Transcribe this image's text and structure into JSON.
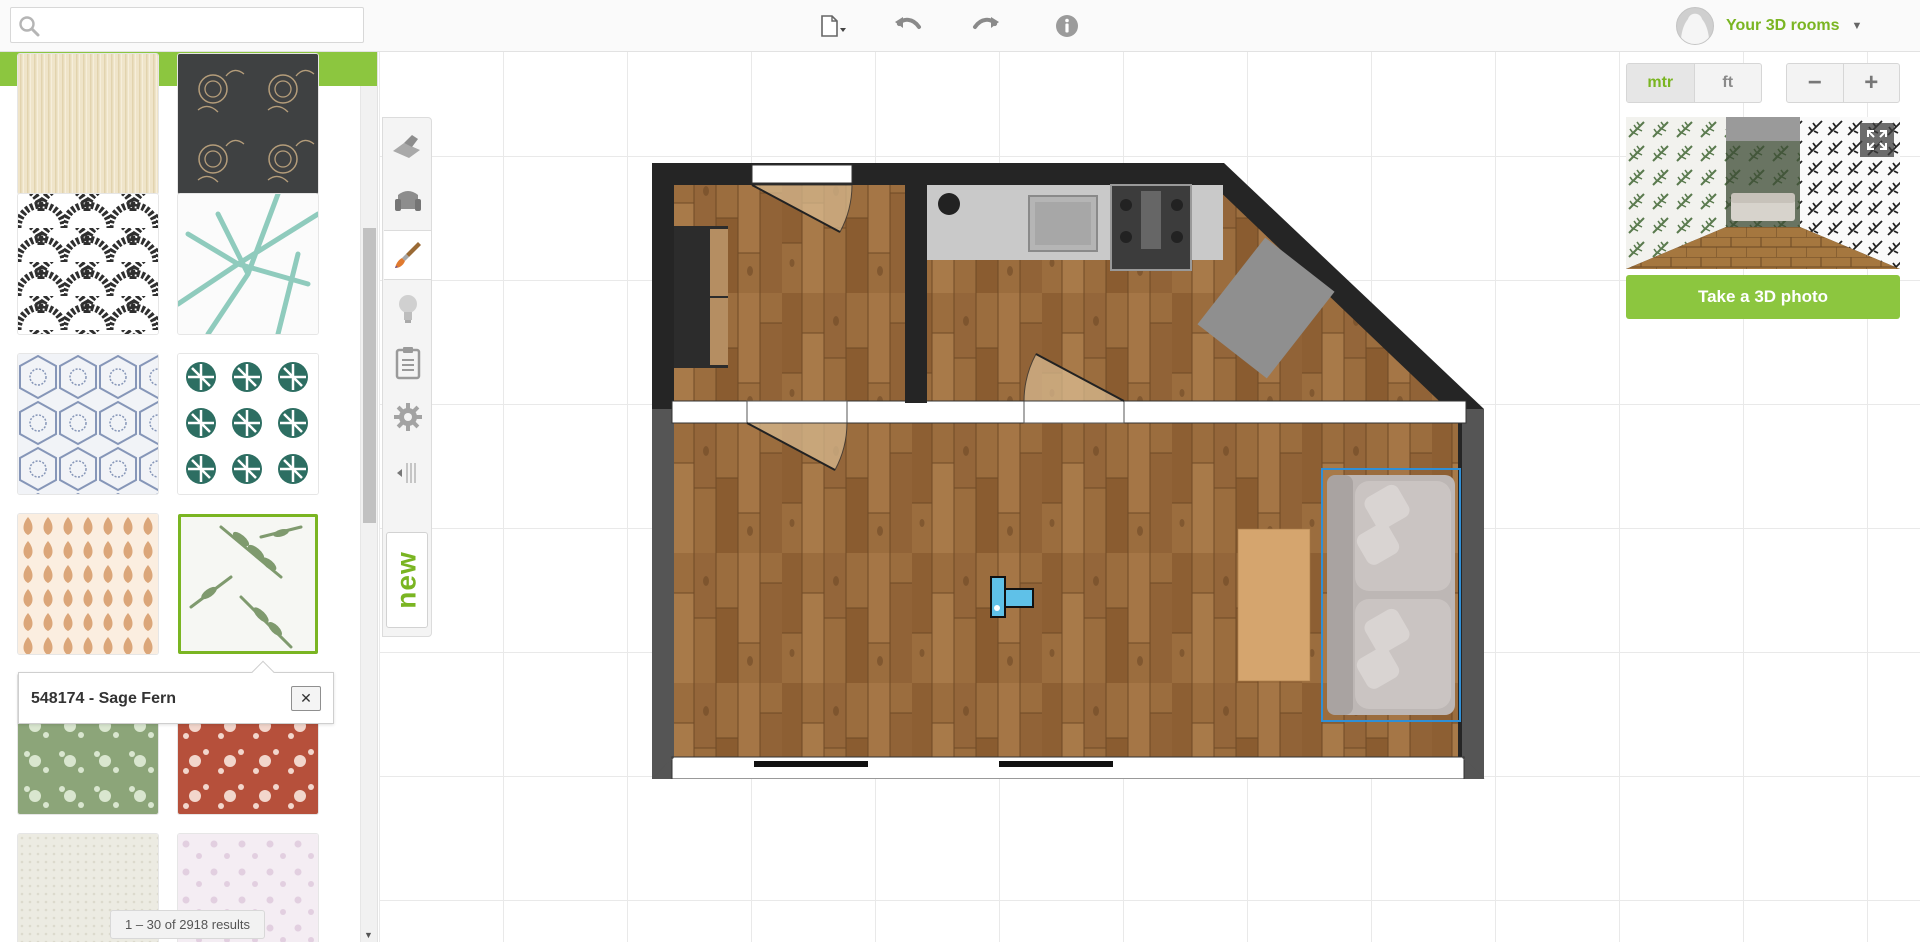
{
  "search": {
    "placeholder": "",
    "value": ""
  },
  "toolbar": {
    "file_icon": "file-icon",
    "undo_icon": "undo-icon",
    "redo_icon": "redo-icon",
    "info_icon": "info-icon"
  },
  "user": {
    "label": "Your 3D rooms",
    "caret": "▼"
  },
  "panel": {
    "tooltip_text": "548174 - Sage Fern",
    "close_symbol": "✕",
    "results_text": "1 – 30 of 2918 results"
  },
  "units": {
    "metric": "mtr",
    "imperial": "ft",
    "active": "mtr"
  },
  "zoom": {
    "out": "−",
    "in": "+"
  },
  "photo_button": "Take a 3D photo",
  "side_tools": [
    "wall-tool-icon",
    "furniture-icon",
    "paint-brush-icon",
    "light-bulb-icon",
    "clipboard-icon",
    "settings-icon",
    "collapse-icon"
  ],
  "new_label": "new",
  "colors": {
    "accent": "#8cc63f",
    "accent_text": "#7ab522",
    "selection": "#2f8fd6"
  }
}
